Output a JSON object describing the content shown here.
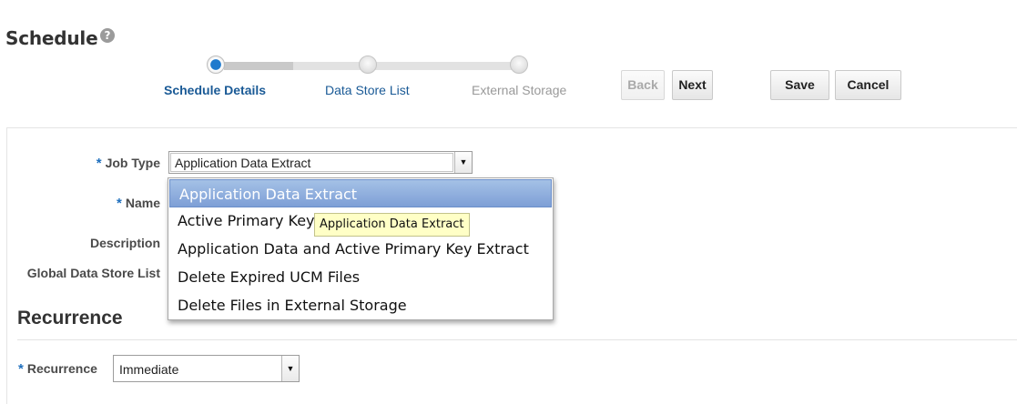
{
  "header": {
    "title": "Schedule",
    "help_icon": "?"
  },
  "train": {
    "steps": [
      {
        "label": "Schedule Details",
        "state": "current"
      },
      {
        "label": "Data Store List",
        "state": "link"
      },
      {
        "label": "External Storage",
        "state": "future"
      }
    ]
  },
  "toolbar": {
    "back_label": "Back",
    "next_label": "Next",
    "save_label": "Save",
    "cancel_label": "Cancel"
  },
  "form": {
    "required_marker": "*",
    "job_type": {
      "label": "Job Type",
      "value": "Application Data Extract"
    },
    "name": {
      "label": "Name"
    },
    "description": {
      "label": "Description"
    },
    "global_data_store_list": {
      "label": "Global Data Store List"
    }
  },
  "dropdown": {
    "options": [
      "Application Data Extract",
      "Active Primary Key",
      "Application Data and Active Primary Key Extract",
      "Delete Expired UCM Files",
      "Delete Files in External Storage"
    ],
    "selected_index": 0,
    "tooltip": "Application Data Extract"
  },
  "recurrence": {
    "section_title": "Recurrence",
    "label": "Recurrence",
    "value": "Immediate"
  },
  "colors": {
    "accent": "#1f7acd",
    "link": "#1a5a96",
    "required": "#1f6fbd",
    "tooltip_bg": "#ffffc6"
  }
}
